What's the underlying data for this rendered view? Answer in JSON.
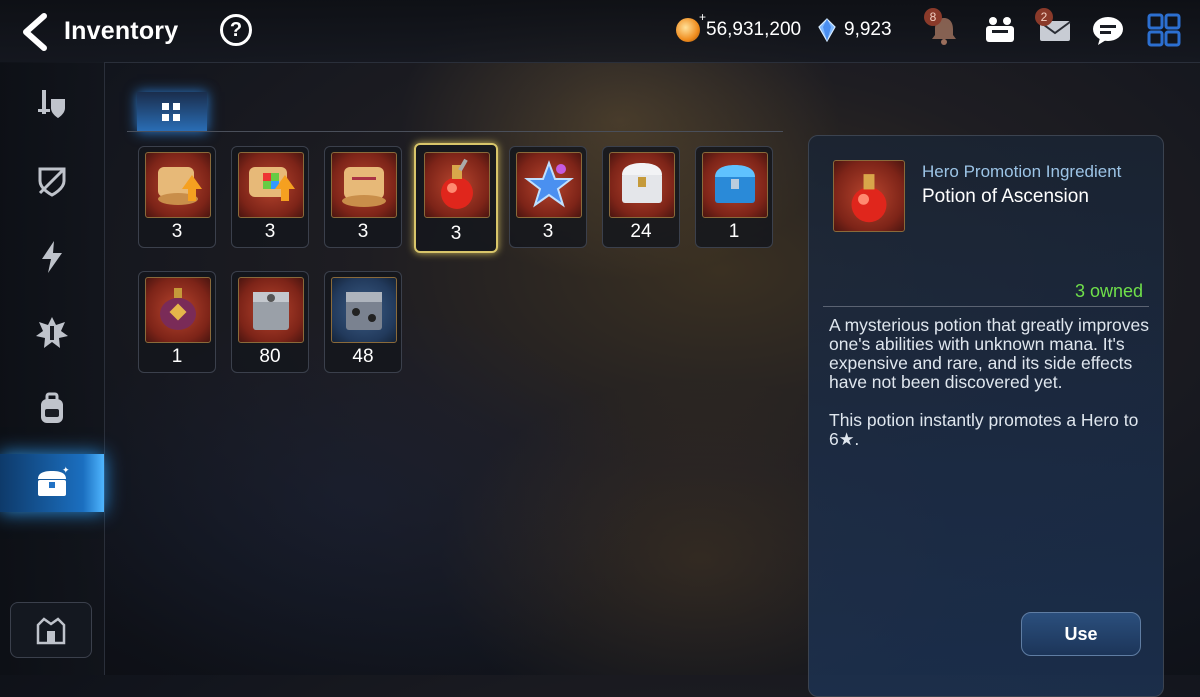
{
  "header": {
    "title": "Inventory",
    "help": "?",
    "gold": "56,931,200",
    "crystals": "9,923",
    "bell_badge": "8",
    "mail_badge": "2"
  },
  "sidebar": {
    "items": [
      {
        "icon": "sword-shield-icon",
        "active": false
      },
      {
        "icon": "broken-shield-icon",
        "active": false
      },
      {
        "icon": "lightning-icon",
        "active": false
      },
      {
        "icon": "gear-burst-icon",
        "active": false
      },
      {
        "icon": "backpack-icon",
        "active": false
      },
      {
        "icon": "treasure-chest-icon",
        "active": true
      }
    ],
    "bottom_icon": "castle-icon"
  },
  "tabs": [
    {
      "icon": "grid-icon",
      "active": true
    }
  ],
  "items": [
    {
      "icon": "scroll-up-icon",
      "qty": "3"
    },
    {
      "icon": "rainbow-scroll-icon",
      "qty": "3"
    },
    {
      "icon": "scroll-icon",
      "qty": "3"
    },
    {
      "icon": "red-potion-icon",
      "qty": "3",
      "selected": true
    },
    {
      "icon": "blue-star-icon",
      "qty": "3"
    },
    {
      "icon": "silver-chest-icon",
      "qty": "24"
    },
    {
      "icon": "blue-chest-icon",
      "qty": "1"
    },
    {
      "icon": "lantern-icon",
      "qty": "1"
    },
    {
      "icon": "grey-box-icon",
      "qty": "80"
    },
    {
      "icon": "dark-box-icon",
      "qty": "48"
    }
  ],
  "detail": {
    "category": "Hero Promotion Ingredient",
    "name": "Potion of Ascension",
    "owned": "3 owned",
    "description": "A mysterious potion that greatly improves one's abilities with unknown mana. It's expensive and rare, and its side effects have not been discovered yet.\n\nThis potion instantly promotes a Hero to 6★.",
    "use_label": "Use"
  },
  "colors": {
    "accent": "#2b8fe0",
    "owned": "#6fe04a",
    "selected_border": "#d8c56a"
  }
}
